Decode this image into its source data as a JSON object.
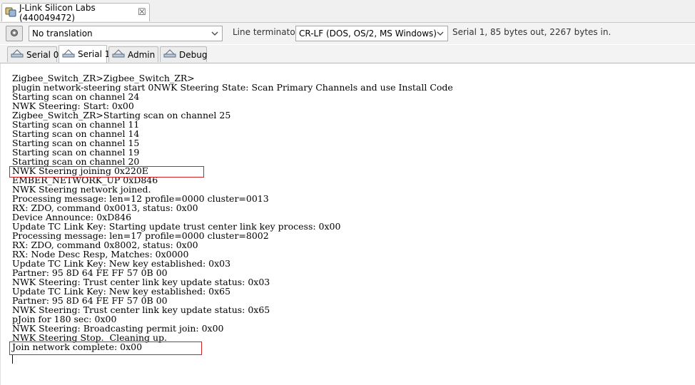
{
  "window": {
    "tab_title": "J-Link Silicon Labs (440049472)",
    "close_glyph": "☒"
  },
  "toolbar": {
    "translation_value": "No translation",
    "line_terminator_label": "Line terminator:",
    "line_terminator_value": "CR-LF  (DOS, OS/2, MS Windows)",
    "status_text": "Serial 1, 85 bytes out, 2267 bytes in."
  },
  "tabs": [
    {
      "label": "Serial 0"
    },
    {
      "label": "Serial 1"
    },
    {
      "label": "Admin"
    },
    {
      "label": "Debug"
    }
  ],
  "console": {
    "lines": [
      "Zigbee_Switch_ZR>Zigbee_Switch_ZR>",
      "plugin network-steering start 0NWK Steering State: Scan Primary Channels and use Install Code",
      "Starting scan on channel 24",
      "NWK Steering: Start: 0x00",
      "Zigbee_Switch_ZR>Starting scan on channel 25",
      "Starting scan on channel 11",
      "Starting scan on channel 14",
      "Starting scan on channel 15",
      "Starting scan on channel 19",
      "Starting scan on channel 20",
      "NWK Steering joining 0x220E",
      "EMBER_NETWORK_UP 0xD846",
      "NWK Steering network joined.",
      "Processing message: len=12 profile=0000 cluster=0013",
      "RX: ZDO, command 0x0013, status: 0x00",
      "Device Announce: 0xD846",
      "Update TC Link Key: Starting update trust center link key process: 0x00",
      "Processing message: len=17 profile=0000 cluster=8002",
      "RX: ZDO, command 0x8002, status: 0x00",
      "RX: Node Desc Resp, Matches: 0x0000",
      "Update TC Link Key: New key established: 0x03",
      "Partner: 95 8D 64 FE FF 57 0B 00",
      "NWK Steering: Trust center link key update status: 0x03",
      "Update TC Link Key: New key established: 0x65",
      "Partner: 95 8D 64 FE FF 57 0B 00",
      "NWK Steering: Trust center link key update status: 0x65",
      "pJoin for 180 sec: 0x00",
      "NWK Steering: Broadcasting permit join: 0x00",
      "NWK Steering Stop.  Cleaning up.",
      "Join network complete: 0x00"
    ]
  },
  "colors": {
    "highlight_border": "#d21f26"
  }
}
